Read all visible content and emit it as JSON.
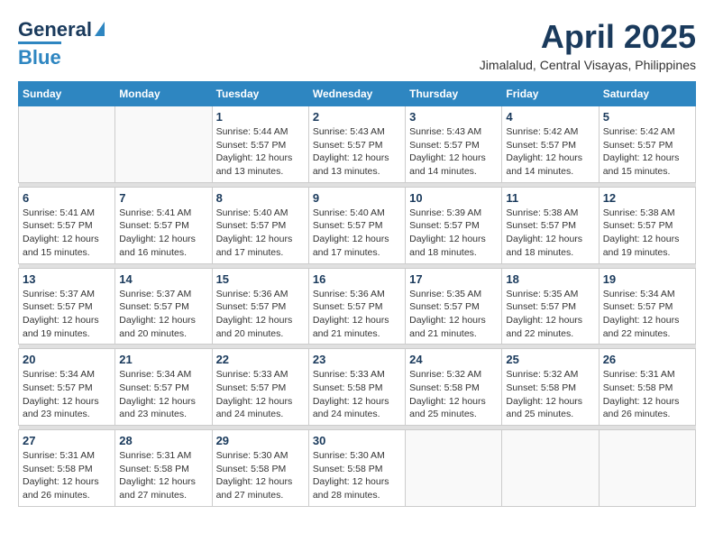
{
  "header": {
    "logo_line1": "General",
    "logo_line2": "Blue",
    "month_year": "April 2025",
    "location": "Jimalalud, Central Visayas, Philippines"
  },
  "weekdays": [
    "Sunday",
    "Monday",
    "Tuesday",
    "Wednesday",
    "Thursday",
    "Friday",
    "Saturday"
  ],
  "weeks": [
    [
      {
        "day": "",
        "info": ""
      },
      {
        "day": "",
        "info": ""
      },
      {
        "day": "1",
        "info": "Sunrise: 5:44 AM\nSunset: 5:57 PM\nDaylight: 12 hours\nand 13 minutes."
      },
      {
        "day": "2",
        "info": "Sunrise: 5:43 AM\nSunset: 5:57 PM\nDaylight: 12 hours\nand 13 minutes."
      },
      {
        "day": "3",
        "info": "Sunrise: 5:43 AM\nSunset: 5:57 PM\nDaylight: 12 hours\nand 14 minutes."
      },
      {
        "day": "4",
        "info": "Sunrise: 5:42 AM\nSunset: 5:57 PM\nDaylight: 12 hours\nand 14 minutes."
      },
      {
        "day": "5",
        "info": "Sunrise: 5:42 AM\nSunset: 5:57 PM\nDaylight: 12 hours\nand 15 minutes."
      }
    ],
    [
      {
        "day": "6",
        "info": "Sunrise: 5:41 AM\nSunset: 5:57 PM\nDaylight: 12 hours\nand 15 minutes."
      },
      {
        "day": "7",
        "info": "Sunrise: 5:41 AM\nSunset: 5:57 PM\nDaylight: 12 hours\nand 16 minutes."
      },
      {
        "day": "8",
        "info": "Sunrise: 5:40 AM\nSunset: 5:57 PM\nDaylight: 12 hours\nand 17 minutes."
      },
      {
        "day": "9",
        "info": "Sunrise: 5:40 AM\nSunset: 5:57 PM\nDaylight: 12 hours\nand 17 minutes."
      },
      {
        "day": "10",
        "info": "Sunrise: 5:39 AM\nSunset: 5:57 PM\nDaylight: 12 hours\nand 18 minutes."
      },
      {
        "day": "11",
        "info": "Sunrise: 5:38 AM\nSunset: 5:57 PM\nDaylight: 12 hours\nand 18 minutes."
      },
      {
        "day": "12",
        "info": "Sunrise: 5:38 AM\nSunset: 5:57 PM\nDaylight: 12 hours\nand 19 minutes."
      }
    ],
    [
      {
        "day": "13",
        "info": "Sunrise: 5:37 AM\nSunset: 5:57 PM\nDaylight: 12 hours\nand 19 minutes."
      },
      {
        "day": "14",
        "info": "Sunrise: 5:37 AM\nSunset: 5:57 PM\nDaylight: 12 hours\nand 20 minutes."
      },
      {
        "day": "15",
        "info": "Sunrise: 5:36 AM\nSunset: 5:57 PM\nDaylight: 12 hours\nand 20 minutes."
      },
      {
        "day": "16",
        "info": "Sunrise: 5:36 AM\nSunset: 5:57 PM\nDaylight: 12 hours\nand 21 minutes."
      },
      {
        "day": "17",
        "info": "Sunrise: 5:35 AM\nSunset: 5:57 PM\nDaylight: 12 hours\nand 21 minutes."
      },
      {
        "day": "18",
        "info": "Sunrise: 5:35 AM\nSunset: 5:57 PM\nDaylight: 12 hours\nand 22 minutes."
      },
      {
        "day": "19",
        "info": "Sunrise: 5:34 AM\nSunset: 5:57 PM\nDaylight: 12 hours\nand 22 minutes."
      }
    ],
    [
      {
        "day": "20",
        "info": "Sunrise: 5:34 AM\nSunset: 5:57 PM\nDaylight: 12 hours\nand 23 minutes."
      },
      {
        "day": "21",
        "info": "Sunrise: 5:34 AM\nSunset: 5:57 PM\nDaylight: 12 hours\nand 23 minutes."
      },
      {
        "day": "22",
        "info": "Sunrise: 5:33 AM\nSunset: 5:57 PM\nDaylight: 12 hours\nand 24 minutes."
      },
      {
        "day": "23",
        "info": "Sunrise: 5:33 AM\nSunset: 5:58 PM\nDaylight: 12 hours\nand 24 minutes."
      },
      {
        "day": "24",
        "info": "Sunrise: 5:32 AM\nSunset: 5:58 PM\nDaylight: 12 hours\nand 25 minutes."
      },
      {
        "day": "25",
        "info": "Sunrise: 5:32 AM\nSunset: 5:58 PM\nDaylight: 12 hours\nand 25 minutes."
      },
      {
        "day": "26",
        "info": "Sunrise: 5:31 AM\nSunset: 5:58 PM\nDaylight: 12 hours\nand 26 minutes."
      }
    ],
    [
      {
        "day": "27",
        "info": "Sunrise: 5:31 AM\nSunset: 5:58 PM\nDaylight: 12 hours\nand 26 minutes."
      },
      {
        "day": "28",
        "info": "Sunrise: 5:31 AM\nSunset: 5:58 PM\nDaylight: 12 hours\nand 27 minutes."
      },
      {
        "day": "29",
        "info": "Sunrise: 5:30 AM\nSunset: 5:58 PM\nDaylight: 12 hours\nand 27 minutes."
      },
      {
        "day": "30",
        "info": "Sunrise: 5:30 AM\nSunset: 5:58 PM\nDaylight: 12 hours\nand 28 minutes."
      },
      {
        "day": "",
        "info": ""
      },
      {
        "day": "",
        "info": ""
      },
      {
        "day": "",
        "info": ""
      }
    ]
  ]
}
